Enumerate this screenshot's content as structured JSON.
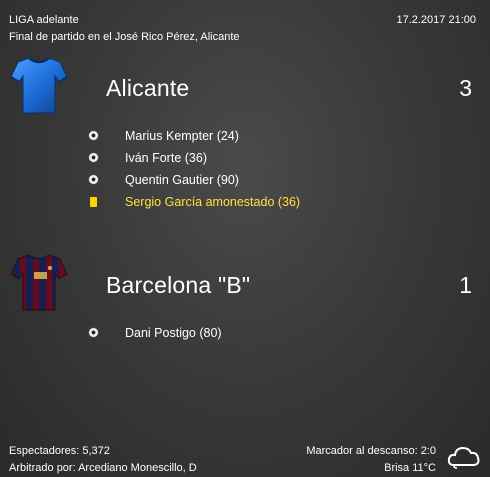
{
  "header": {
    "competition": "LIGA adelante",
    "subtitle": "Final de partido en el José Rico Pérez, Alicante",
    "datetime": "17.2.2017 21:00"
  },
  "home": {
    "name": "Alicante",
    "score": "3",
    "shirt_icon": "blue-shirt-icon",
    "shirt_color": "#1e6fd9",
    "events": [
      {
        "type": "goal",
        "icon": "football-icon",
        "text": "Marius Kempter (24)"
      },
      {
        "type": "goal",
        "icon": "football-icon",
        "text": "Iván Forte (36)"
      },
      {
        "type": "goal",
        "icon": "football-icon",
        "text": "Quentin Gautier (90)"
      },
      {
        "type": "card",
        "icon": "yellow-card-icon",
        "text": "Sergio García amonestado (36)"
      }
    ]
  },
  "away": {
    "name": "Barcelona \"B\"",
    "score": "1",
    "shirt_icon": "barcelona-shirt-icon",
    "events": [
      {
        "type": "goal",
        "icon": "football-icon",
        "text": "Dani Postigo (80)"
      }
    ]
  },
  "footer": {
    "spectators": "Espectadores: 5,372",
    "referee": "Arbitrado por: Arcediano Monescillo, D",
    "halftime": "Marcador al descanso: 2:0",
    "weather": "Brisa 11°C",
    "weather_icon": "cloudy-icon"
  },
  "colors": {
    "card_text": "#ffe23a",
    "yellow_card": "#ffd400"
  }
}
